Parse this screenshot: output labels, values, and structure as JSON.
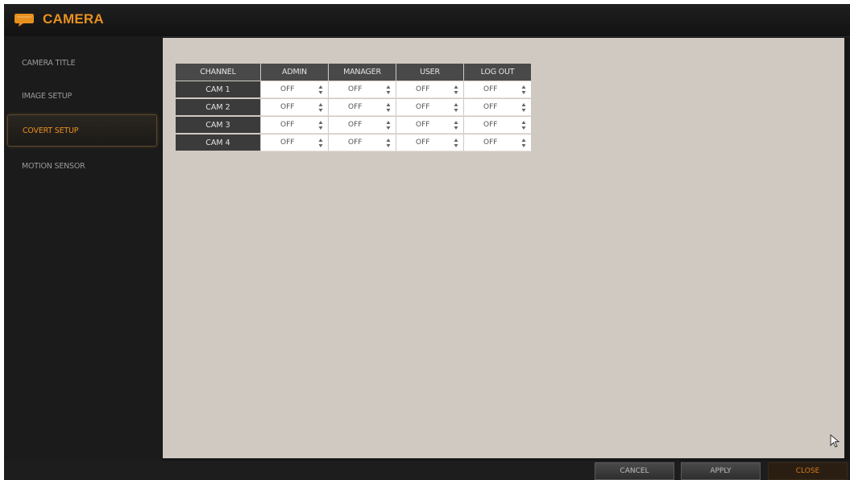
{
  "app": {
    "title": "CAMERA",
    "accent_color": "#e8901f",
    "title_icon": "chat-bubble-icon"
  },
  "sidebar": {
    "items": [
      {
        "label": "CAMERA TITLE",
        "active": false
      },
      {
        "label": "IMAGE SETUP",
        "active": false
      },
      {
        "label": "COVERT SETUP",
        "active": true
      },
      {
        "label": "MOTION SENSOR",
        "active": false
      }
    ]
  },
  "table": {
    "headers": [
      "CHANNEL",
      "ADMIN",
      "MANAGER",
      "USER",
      "LOG OUT"
    ],
    "rows": [
      {
        "channel": "CAM 1",
        "values": [
          "OFF",
          "OFF",
          "OFF",
          "OFF"
        ]
      },
      {
        "channel": "CAM 2",
        "values": [
          "OFF",
          "OFF",
          "OFF",
          "OFF"
        ]
      },
      {
        "channel": "CAM 3",
        "values": [
          "OFF",
          "OFF",
          "OFF",
          "OFF"
        ]
      },
      {
        "channel": "CAM 4",
        "values": [
          "OFF",
          "OFF",
          "OFF",
          "OFF"
        ]
      }
    ]
  },
  "footer": {
    "cancel_label": "CANCEL",
    "apply_label": "APPLY",
    "close_label": "CLOSE"
  }
}
